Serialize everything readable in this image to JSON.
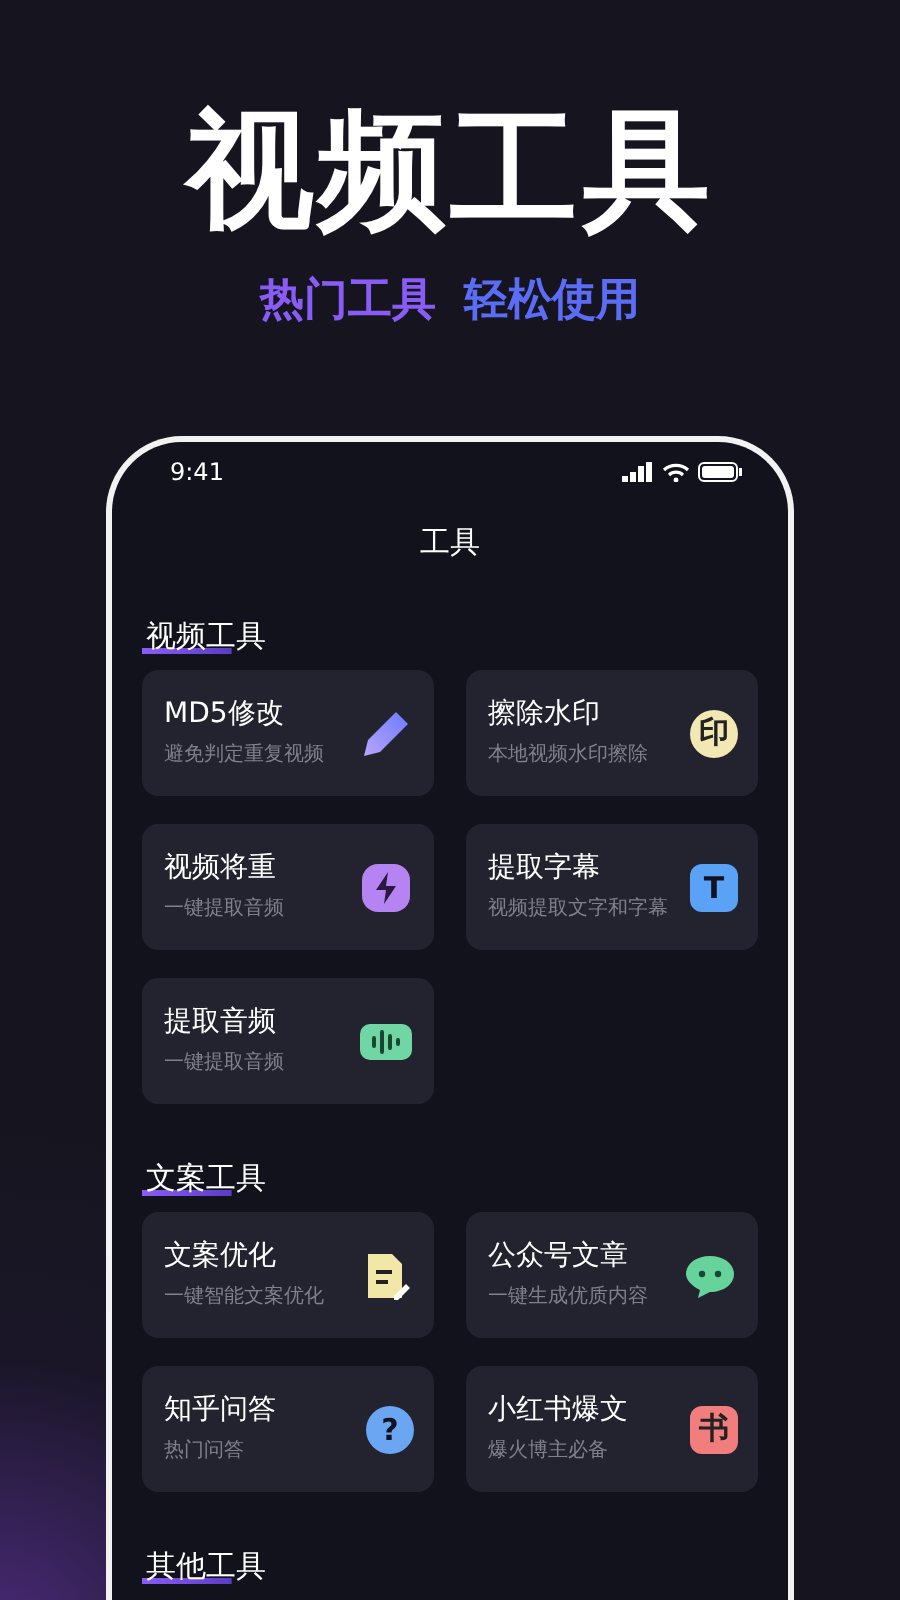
{
  "headline": "视频工具",
  "tagline": [
    {
      "text": "热门工具",
      "color": "#8a5cf6"
    },
    {
      "text": "轻松使用",
      "color": "#5b6cf6"
    }
  ],
  "status_bar": {
    "time": "9:41"
  },
  "screen_title": "工具",
  "sections": [
    {
      "title": "视频工具",
      "tools": [
        {
          "name": "MD5修改",
          "desc": "避免判定重复视频",
          "kind": "pencil"
        },
        {
          "name": "擦除水印",
          "desc": "本地视频水印擦除",
          "kind": "stamp",
          "glyph": "印"
        },
        {
          "name": "视频将重",
          "desc": "一键提取音频",
          "kind": "bolt"
        },
        {
          "name": "提取字幕",
          "desc": "视频提取文字和字幕",
          "kind": "letter",
          "glyph": "T"
        },
        {
          "name": "提取音频",
          "desc": "一键提取音频",
          "kind": "wave"
        }
      ]
    },
    {
      "title": "文案工具",
      "tools": [
        {
          "name": "文案优化",
          "desc": "一键智能文案优化",
          "kind": "doc"
        },
        {
          "name": "公众号文章",
          "desc": "一键生成优质内容",
          "kind": "chat"
        },
        {
          "name": "知乎问答",
          "desc": "热门问答",
          "kind": "question",
          "glyph": "?"
        },
        {
          "name": "小红书爆文",
          "desc": "爆火博主必备",
          "kind": "book",
          "glyph": "书"
        }
      ]
    },
    {
      "title": "其他工具"
    }
  ]
}
